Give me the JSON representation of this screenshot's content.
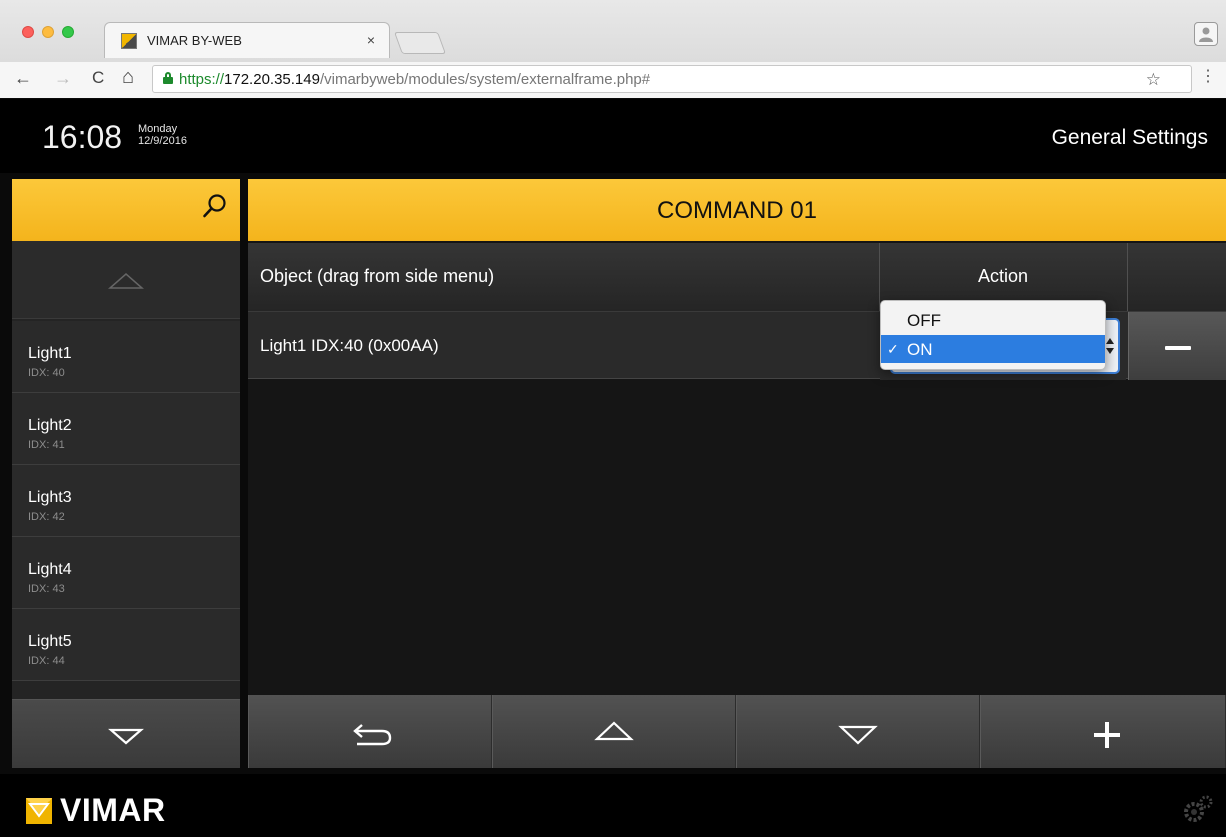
{
  "browser": {
    "tab_title": "VIMAR BY-WEB",
    "tab_close": "×",
    "url_scheme": "https://",
    "url_host": "172.20.35.149",
    "url_path": "/vimarbyweb/modules/system/externalframe.php#",
    "back": "←",
    "forward": "→",
    "reload": "C",
    "home": "⌂",
    "star": "☆",
    "menu": "⋮",
    "profile": "👤"
  },
  "header": {
    "time": "16:08",
    "day": "Monday",
    "date": "12/9/2016",
    "title": "General Settings"
  },
  "sidebar": {
    "items": [
      {
        "name": "Light1",
        "idx": "IDX: 40"
      },
      {
        "name": "Light2",
        "idx": "IDX: 41"
      },
      {
        "name": "Light3",
        "idx": "IDX: 42"
      },
      {
        "name": "Light4",
        "idx": "IDX: 43"
      },
      {
        "name": "Light5",
        "idx": "IDX: 44"
      }
    ]
  },
  "main": {
    "title": "COMMAND 01",
    "col_object": "Object (drag from side menu)",
    "col_action": "Action",
    "row": {
      "object": "Light1 IDX:40 (0x00AA)"
    },
    "dropdown": {
      "options": [
        "OFF",
        "ON"
      ],
      "selected_check": "✓",
      "selected": "ON"
    }
  },
  "footer": {
    "brand": "VIMAR"
  },
  "colors": {
    "accent": "#f8c12e",
    "select_highlight": "#2c7de0",
    "background": "#151515"
  }
}
